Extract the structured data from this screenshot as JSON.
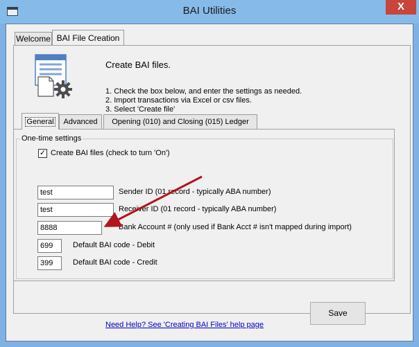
{
  "window": {
    "title": "BAI Utilities",
    "close_glyph": "X"
  },
  "tabs_top": [
    {
      "label": "Welcome",
      "active": false
    },
    {
      "label": "BAI File Creation",
      "active": true
    }
  ],
  "description": {
    "title": "Create BAI files.",
    "steps": [
      "1. Check the box below, and enter the settings as needed.",
      "2. Import transactions via Excel or csv files.",
      "3. Select 'Create file'"
    ],
    "icon": "document-settings-icon"
  },
  "tabs_inner": [
    {
      "label": "General",
      "active": true
    },
    {
      "label": "Advanced",
      "active": false
    },
    {
      "label": "Opening (010) and Closing (015) Ledger",
      "active": false
    }
  ],
  "one_time": {
    "group_label": "One-time settings",
    "create_checkbox": {
      "checked": true,
      "glyph": "✓",
      "label": "Create BAI files (check to turn 'On')"
    },
    "sender": {
      "value": "test",
      "label": "Sender ID (01 record - typically ABA number)"
    },
    "receiver": {
      "value": "test",
      "label": "Receiver ID (01 record - typically ABA number)"
    },
    "bank_account": {
      "value": "8888",
      "label": "Bank Account # (only used if Bank Acct # isn't mapped during import)"
    },
    "debit_code": {
      "value": "699",
      "label": "Default BAI code - Debit"
    },
    "credit_code": {
      "value": "399",
      "label": "Default BAI code - Credit"
    }
  },
  "footer": {
    "save_label": "Save",
    "help_link": "Need Help? See 'Creating BAI Files' help page"
  },
  "colors": {
    "title_bar": "#86bbe9",
    "close": "#c7453a",
    "arrow": "#b3141d",
    "link": "#0000cc"
  }
}
